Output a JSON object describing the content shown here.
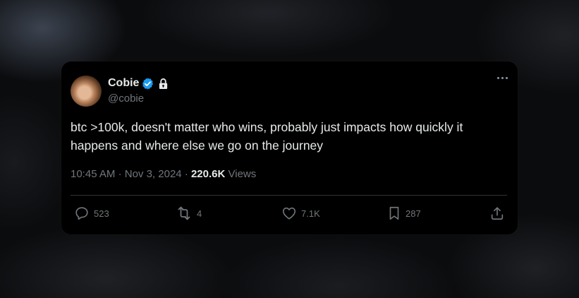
{
  "tweet": {
    "author": {
      "display_name": "Cobie",
      "handle": "@cobie",
      "avatar_icon": "profile-photo",
      "verified_icon": "verified-badge-icon",
      "protected_icon": "lock-icon"
    },
    "text": "btc >100k, doesn't matter who wins, probably just impacts how quickly it happens and where else we go on the journey",
    "time": "10:45 AM",
    "date": "Nov 3, 2024",
    "separator": "·",
    "views_count": "220.6K",
    "views_label": "Views",
    "actions": {
      "replies": "523",
      "reposts": "4",
      "likes": "7.1K",
      "bookmarks": "287"
    }
  },
  "colors": {
    "card_background": "#000000",
    "text_primary": "#e7e9ea",
    "text_secondary": "#71767b",
    "verified_blue": "#1d9bf0",
    "divider": "#2f3336"
  }
}
